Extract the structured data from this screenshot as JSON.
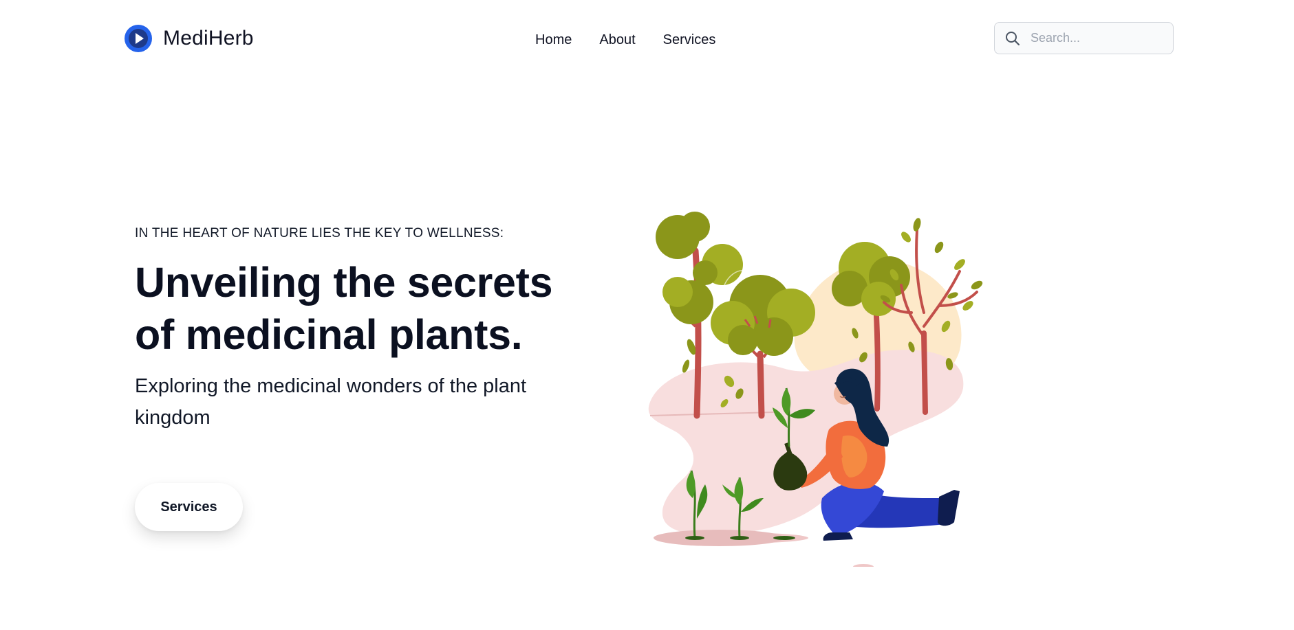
{
  "brand": {
    "name": "MediHerb",
    "accent_color": "#1d4ed8",
    "logo_icon": "play-circle-icon"
  },
  "nav": {
    "items": [
      {
        "label": "Home"
      },
      {
        "label": "About"
      },
      {
        "label": "Services"
      }
    ]
  },
  "search": {
    "placeholder": "Search...",
    "value": "",
    "icon": "search-icon"
  },
  "hero": {
    "eyebrow": "IN THE HEART OF NATURE LIES THE KEY TO WELLNESS:",
    "headline_line1": "Unveiling the secrets",
    "headline_line2": "of medicinal plants.",
    "subheading": "Exploring the medicinal wonders of the plant kingdom",
    "cta_label": "Services"
  },
  "colors": {
    "text": "#0f1222",
    "tree_green": "#8a9a1a",
    "trunk_red": "#c0504a",
    "ground_pink": "#f6dcdc",
    "sun_cream": "#fde9c9",
    "jacket_orange": "#f26d3d",
    "pants_blue": "#3448d6",
    "hair_navy": "#0e2747"
  }
}
